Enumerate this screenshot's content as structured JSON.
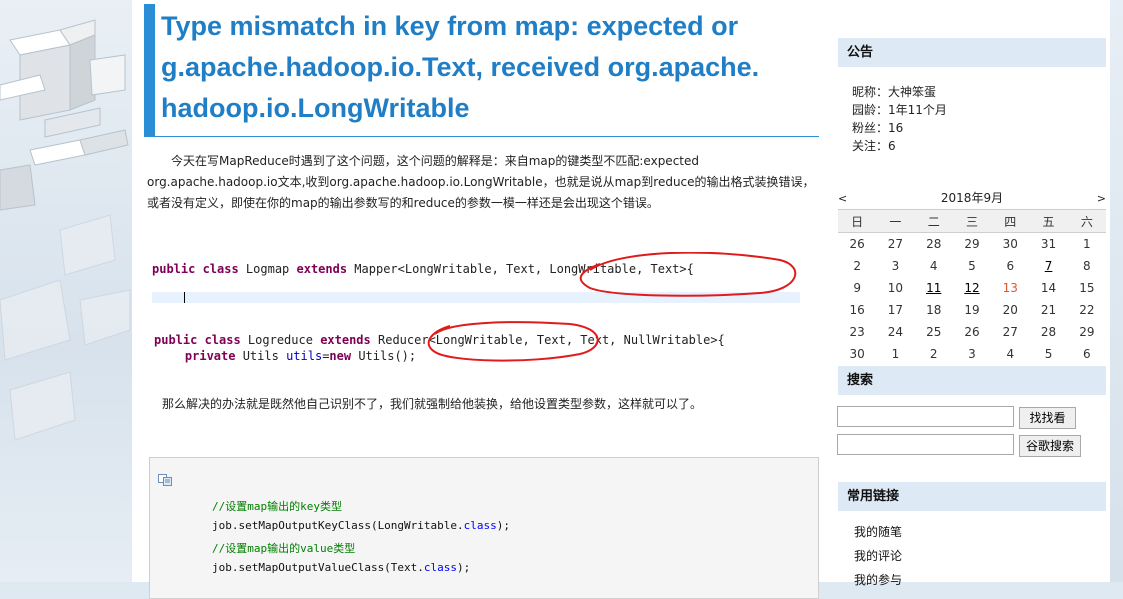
{
  "post": {
    "title": "Type mismatch in key from map: expected org.apache.hadoop.io.Text, received org.apache.hadoop.io.LongWritable",
    "para1": "今天在写MapReduce时遇到了这个问题，这个问题的解释是：来自map的键类型不匹配:expected org.apache.hadoop.io文本,收到org.apache.hadoop.io.LongWritable，也就是说从map到reduce的输出格式装换错误，或者没有定义，即使在你的map的输出参数写的和reduce的参数一模一样还是会出现这个错误。",
    "para2": "那么解决的办法就是既然他自己识别不了，我们就强制给他装换，给他设置类型参数，这样就可以了。"
  },
  "code_screenshot": {
    "line1_kw": "public class",
    "line1_a": " Logmap ",
    "line1_kw2": "extends",
    "line1_b": " Mapper<LongWritable, Text, LongWritable, Text>{",
    "line2_kw": "public class",
    "line2_a": " Logreduce ",
    "line2_kw2": "extends",
    "line2_b": " Reducer<LongWritable, Text, Text, NullWritable>{",
    "line3_kw": "private",
    "line3_a": " Utils ",
    "line3_fld": "utils",
    "line3_b": "=",
    "line3_kw2": "new",
    "line3_c": " Utils();"
  },
  "code_box": {
    "comment1": "//设置map输出的key类型",
    "line1_a": "job.setMapOutputKeyClass(LongWritable.",
    "line1_kw": "class",
    "line1_b": ");",
    "comment2": "//设置map输出的value类型",
    "line2_a": "job.setMapOutputValueClass(Text.",
    "line2_kw": "class",
    "line2_b": ");"
  },
  "sidebar": {
    "notice_title": "公告",
    "nickname": "昵称：大神笨蛋",
    "age": "园龄：1年11个月",
    "fans": "粉丝：16",
    "follow": "关注：6",
    "calendar": {
      "prev": "<",
      "month": "2018年9月",
      "next": ">",
      "weekdays": [
        "日",
        "一",
        "二",
        "三",
        "四",
        "五",
        "六"
      ],
      "weeks": [
        [
          "26",
          "27",
          "28",
          "29",
          "30",
          "31",
          "1"
        ],
        [
          "2",
          "3",
          "4",
          "5",
          "6",
          "7",
          "8"
        ],
        [
          "9",
          "10",
          "11",
          "12",
          "13",
          "14",
          "15"
        ],
        [
          "16",
          "17",
          "18",
          "19",
          "20",
          "21",
          "22"
        ],
        [
          "23",
          "24",
          "25",
          "26",
          "27",
          "28",
          "29"
        ],
        [
          "30",
          "1",
          "2",
          "3",
          "4",
          "5",
          "6"
        ]
      ],
      "linked_days": [
        "7",
        "11",
        "12"
      ],
      "today": "13"
    },
    "search_title": "搜索",
    "search_btn1": "找找看",
    "search_btn2": "谷歌搜索",
    "links_title": "常用链接",
    "links": [
      "我的随笔",
      "我的评论",
      "我的参与"
    ]
  },
  "colors": {
    "accent": "#2a8ed6",
    "title": "#1f7ec6",
    "annotation": "#e01b1b"
  }
}
